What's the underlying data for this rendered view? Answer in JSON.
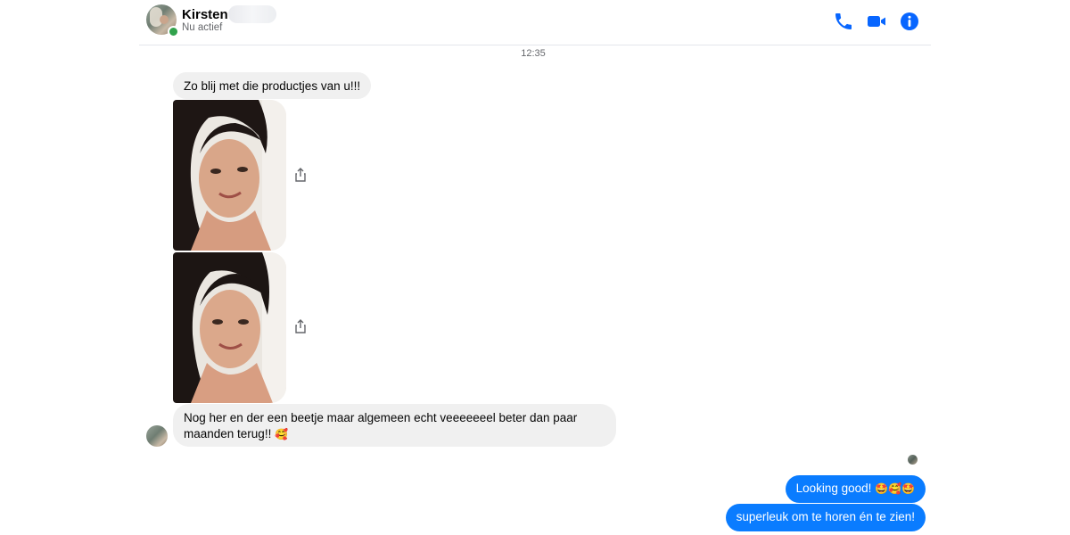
{
  "header": {
    "contact_name": "Kirsten",
    "status": "Nu actief"
  },
  "conversation": {
    "timestamp": "12:35",
    "messages": [
      {
        "from": "contact",
        "text": "Zo blij met die productjes van u!!!"
      },
      {
        "from": "contact",
        "type": "photo"
      },
      {
        "from": "contact",
        "type": "photo"
      },
      {
        "from": "contact",
        "text": "Nog her en der een beetje maar algemeen echt veeeeeeel beter dan paar maanden terug!!",
        "emoji": "🥰"
      },
      {
        "from": "me",
        "text": "Looking good!",
        "emoji": "🤩🥰🤩"
      },
      {
        "from": "me",
        "text": "superleuk om te horen én te zien!"
      }
    ]
  },
  "colors": {
    "accent": "#0a7cff",
    "icon": "#0866ff",
    "incoming_bubble": "#f0f0f0",
    "online": "#31a24c"
  },
  "icons": [
    "phone-icon",
    "video-camera-icon",
    "info-icon",
    "share-icon"
  ]
}
